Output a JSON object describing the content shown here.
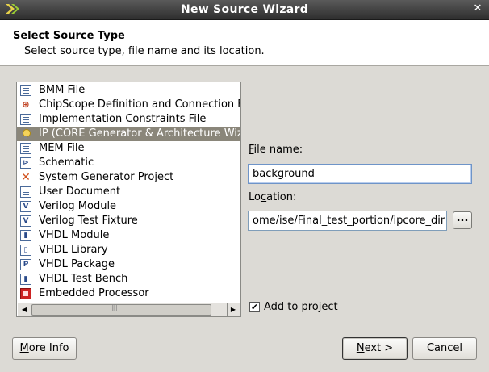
{
  "window": {
    "title": "New Source Wizard"
  },
  "header": {
    "title": "Select Source Type",
    "subtitle": "Select source type, file name and its location."
  },
  "source_types": [
    {
      "label": "BMM File",
      "icon": "doc-icon",
      "glyph": ""
    },
    {
      "label": "ChipScope Definition and Connection File",
      "icon": "chipscope-icon",
      "glyph": "⊕"
    },
    {
      "label": "Implementation Constraints File",
      "icon": "doc-icon",
      "glyph": ""
    },
    {
      "label": "IP (CORE Generator & Architecture Wizard)",
      "icon": "ip-lightbulb-icon",
      "glyph": "",
      "selected": true
    },
    {
      "label": "MEM File",
      "icon": "doc-icon",
      "glyph": ""
    },
    {
      "label": "Schematic",
      "icon": "schematic-icon",
      "glyph": "⊳"
    },
    {
      "label": "System Generator Project",
      "icon": "sysgen-icon",
      "glyph": ""
    },
    {
      "label": "User Document",
      "icon": "doc-icon",
      "glyph": ""
    },
    {
      "label": "Verilog Module",
      "icon": "verilog-icon",
      "glyph": "V"
    },
    {
      "label": "Verilog Test Fixture",
      "icon": "verilog-test-icon",
      "glyph": "V"
    },
    {
      "label": "VHDL Module",
      "icon": "vhdl-icon",
      "glyph": "▮"
    },
    {
      "label": "VHDL Library",
      "icon": "vhdl-library-icon",
      "glyph": "▯"
    },
    {
      "label": "VHDL Package",
      "icon": "vhdl-package-icon",
      "glyph": "P"
    },
    {
      "label": "VHDL Test Bench",
      "icon": "vhdl-testbench-icon",
      "glyph": "▮"
    },
    {
      "label": "Embedded Processor",
      "icon": "processor-icon",
      "glyph": ""
    }
  ],
  "form": {
    "file_name_label": "File name:",
    "file_name_value": "background",
    "location_label": "Location:",
    "location_value": "ome/ise/Final_test_portion/ipcore_dir",
    "browse_label": "...",
    "add_to_project_label": "Add to project",
    "add_to_project_checked": true
  },
  "buttons": {
    "more_info": "More Info",
    "next": "Next >",
    "cancel": "Cancel"
  }
}
